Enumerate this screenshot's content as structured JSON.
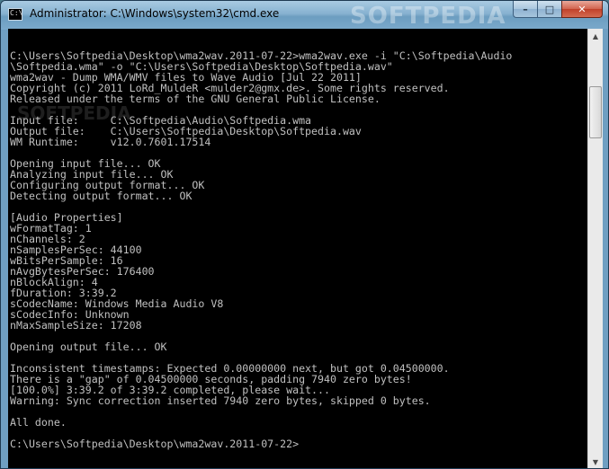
{
  "window": {
    "title": "Administrator: C:\\Windows\\system32\\cmd.exe",
    "icon": "cmd-icon",
    "icon_text": "C:\\",
    "watermark": "SOFTPEDIA"
  },
  "caption": {
    "minimize": "–",
    "maximize": "□",
    "close": "✕"
  },
  "scrollbar": {
    "up_arrow": "▲",
    "down_arrow": "▼"
  },
  "console": {
    "watermark": "SOFTPEDIA",
    "lines": [
      "",
      "C:\\Users\\Softpedia\\Desktop\\wma2wav.2011-07-22>wma2wav.exe -i \"C:\\Softpedia\\Audio",
      "\\Softpedia.wma\" -o \"C:\\Users\\Softpedia\\Desktop\\Softpedia.wav\"",
      "wma2wav - Dump WMA/WMV files to Wave Audio [Jul 22 2011]",
      "Copyright (c) 2011 LoRd_MuldeR <mulder2@gmx.de>. Some rights reserved.",
      "Released under the terms of the GNU General Public License.",
      "",
      "Input file:     C:\\Softpedia\\Audio\\Softpedia.wma",
      "Output file:    C:\\Users\\Softpedia\\Desktop\\Softpedia.wav",
      "WM Runtime:     v12.0.7601.17514",
      "",
      "Opening input file... OK",
      "Analyzing input file... OK",
      "Configuring output format... OK",
      "Detecting output format... OK",
      "",
      "[Audio Properties]",
      "wFormatTag: 1",
      "nChannels: 2",
      "nSamplesPerSec: 44100",
      "wBitsPerSample: 16",
      "nAvgBytesPerSec: 176400",
      "nBlockAlign: 4",
      "fDuration: 3:39.2",
      "sCodecName: Windows Media Audio V8",
      "sCodecInfo: Unknown",
      "nMaxSampleSize: 17208",
      "",
      "Opening output file... OK",
      "",
      "Inconsistent timestamps: Expected 0.00000000 next, but got 0.04500000.",
      "There is a \"gap\" of 0.04500000 seconds, padding 7940 zero bytes!",
      "[100.0%] 3:39.2 of 3:39.2 completed, please wait...",
      "Warning: Sync correction inserted 7940 zero bytes, skipped 0 bytes.",
      "",
      "All done.",
      "",
      "C:\\Users\\Softpedia\\Desktop\\wma2wav.2011-07-22>"
    ]
  }
}
